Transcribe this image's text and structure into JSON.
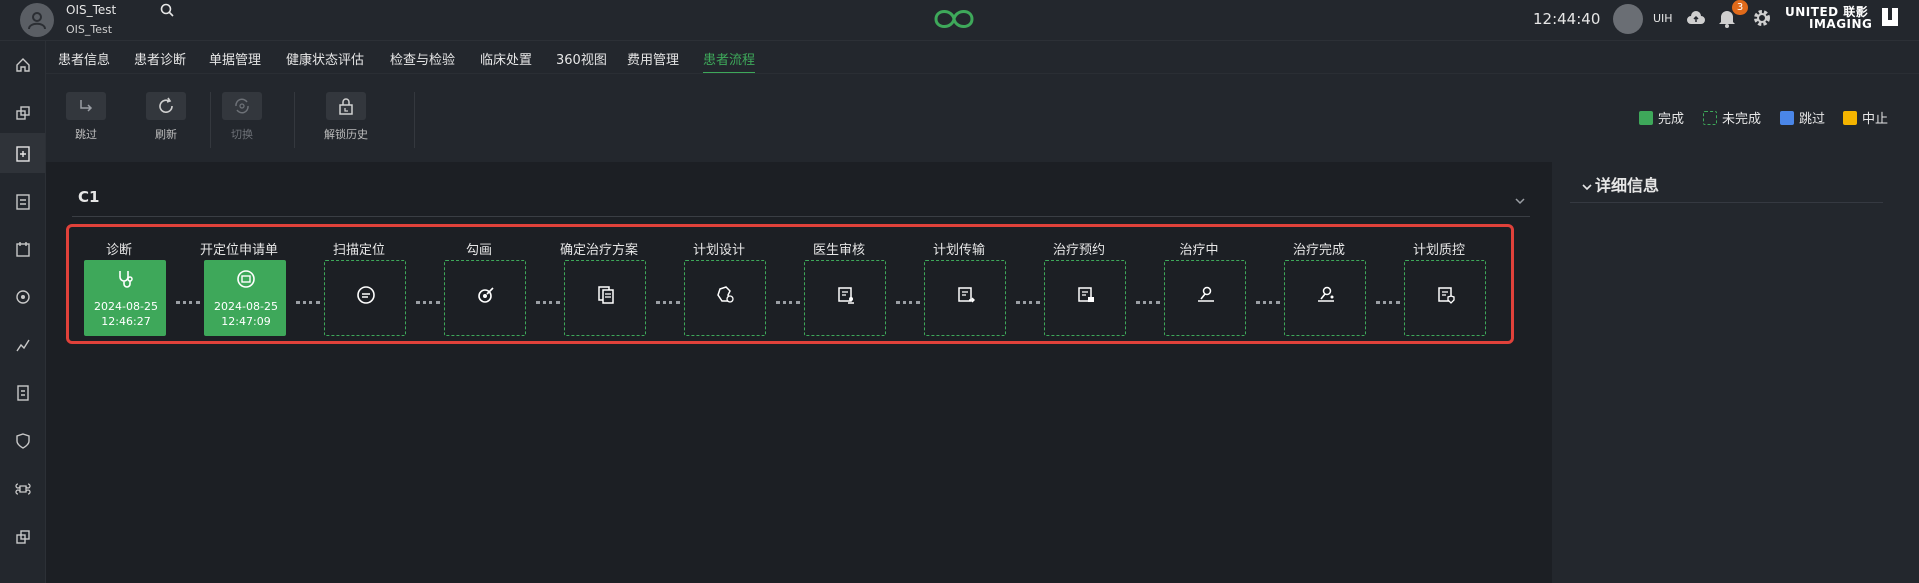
{
  "topbar": {
    "user_name": "OIS_Test",
    "user_sub": "OIS_Test",
    "time": "12:44:40",
    "account": "UIH",
    "notification_count": "3",
    "brand_line1": "UNITED 联影",
    "brand_line2": "IMAGING"
  },
  "nav": {
    "tabs": [
      "患者信息",
      "患者诊断",
      "单据管理",
      "健康状态评估",
      "检查与检验",
      "临床处置",
      "360视图",
      "费用管理",
      "患者流程"
    ],
    "active_index": 8
  },
  "toolbar": {
    "skip": "跳过",
    "refresh": "刷新",
    "switch": "切换",
    "unlock_history": "解锁历史"
  },
  "legend": {
    "done": "完成",
    "undone": "未完成",
    "skipped": "跳过",
    "aborted": "中止",
    "colors": {
      "done": "#3ea85a",
      "undone": "#3ea85a",
      "skipped": "#4a86e8",
      "aborted": "#f4b400"
    }
  },
  "section": {
    "title": "C1"
  },
  "side_panel": {
    "title": "详细信息"
  },
  "steps": [
    {
      "label": "诊断",
      "status": "done",
      "icon": "stethoscope-icon",
      "date": "2024-08-25",
      "time": "12:46:27"
    },
    {
      "label": "开定位申请单",
      "status": "done",
      "icon": "application-icon",
      "date": "2024-08-25",
      "time": "12:47:09"
    },
    {
      "label": "扫描定位",
      "status": "pending",
      "icon": "scan-icon"
    },
    {
      "label": "勾画",
      "status": "pending",
      "icon": "contour-icon"
    },
    {
      "label": "确定治疗方案",
      "status": "pending",
      "icon": "plan-doc-icon"
    },
    {
      "label": "计划设计",
      "status": "pending",
      "icon": "plan-design-icon"
    },
    {
      "label": "医生审核",
      "status": "pending",
      "icon": "doctor-review-icon"
    },
    {
      "label": "计划传输",
      "status": "pending",
      "icon": "plan-transfer-icon"
    },
    {
      "label": "治疗预约",
      "status": "pending",
      "icon": "appointment-icon"
    },
    {
      "label": "治疗中",
      "status": "pending",
      "icon": "treating-icon"
    },
    {
      "label": "治疗完成",
      "status": "pending",
      "icon": "treatment-done-icon"
    },
    {
      "label": "计划质控",
      "status": "pending",
      "icon": "plan-qa-icon"
    }
  ]
}
